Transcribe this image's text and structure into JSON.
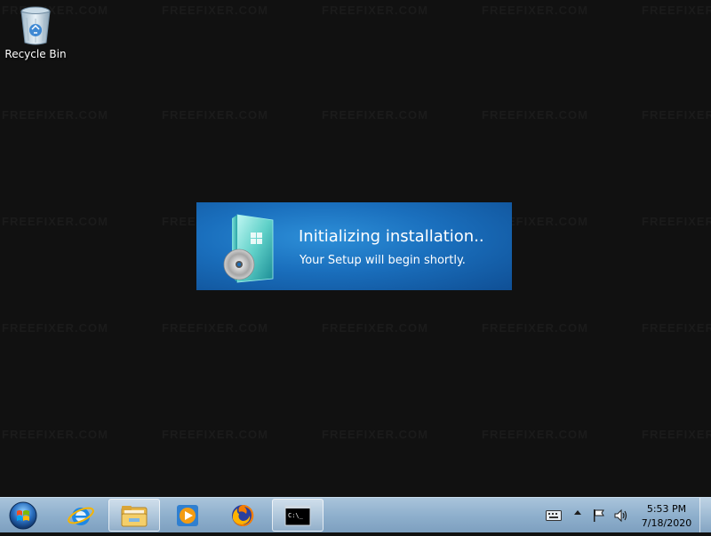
{
  "desktop": {
    "watermark_text": "FREEFIXER.COM",
    "icons": [
      {
        "label": "Recycle Bin",
        "icon": "recycle-bin-icon"
      }
    ]
  },
  "splash": {
    "title": "Initializing installation..",
    "subtitle": "Your Setup will begin shortly.",
    "icon": "windows-setup-box-icon"
  },
  "taskbar": {
    "start_icon": "windows-start-orb-icon",
    "pinned": [
      {
        "name": "Internet Explorer",
        "icon": "internet-explorer-icon",
        "active": false
      },
      {
        "name": "Windows Explorer",
        "icon": "folder-icon",
        "active": true
      },
      {
        "name": "Windows Media Player",
        "icon": "media-player-icon",
        "active": false
      },
      {
        "name": "Firefox",
        "icon": "firefox-icon",
        "active": false
      },
      {
        "name": "Command Prompt",
        "icon": "command-prompt-icon",
        "active": true
      }
    ],
    "cmd_icon_text": "C:\\_",
    "tray": {
      "icons": [
        "keyboard-icon",
        "show-hidden-icons-chevron",
        "action-center-flag-icon",
        "volume-icon"
      ],
      "time": "5:53 PM",
      "date": "7/18/2020"
    }
  },
  "colors": {
    "desktop_bg": "#111111",
    "splash_blue": "#1a6fbd",
    "taskbar": "#8fb0cd"
  }
}
